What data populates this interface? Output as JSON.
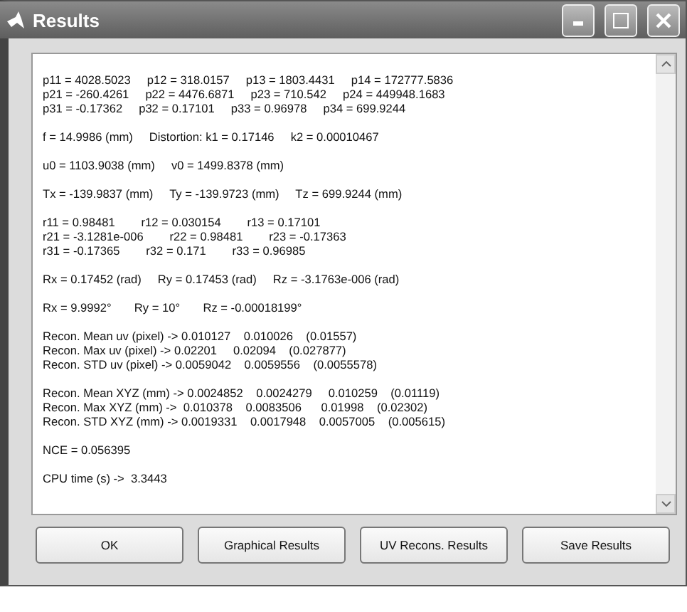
{
  "window": {
    "title": "Results"
  },
  "results": [
    [
      "p11 = 4028.5023     p12 = 318.0157     p13 = 1803.4431     p14 = 172777.5836",
      "p21 = -260.4261     p22 = 4476.6871     p23 = 710.542     p24 = 449948.1683",
      "p31 = -0.17362     p32 = 0.17101     p33 = 0.96978     p34 = 699.9244"
    ],
    [
      "f = 14.9986 (mm)     Distortion: k1 = 0.17146     k2 = 0.00010467"
    ],
    [
      "u0 = 1103.9038 (mm)     v0 = 1499.8378 (mm)"
    ],
    [
      "Tx = -139.9837 (mm)     Ty = -139.9723 (mm)     Tz = 699.9244 (mm)"
    ],
    [
      "r11 = 0.98481        r12 = 0.030154        r13 = 0.17101",
      "r21 = -3.1281e-006        r22 = 0.98481        r23 = -0.17363",
      "r31 = -0.17365        r32 = 0.171        r33 = 0.96985"
    ],
    [
      "Rx = 0.17452 (rad)     Ry = 0.17453 (rad)     Rz = -3.1763e-006 (rad)"
    ],
    [
      "Rx = 9.9992°       Ry = 10°       Rz = -0.00018199°"
    ],
    [
      "Recon. Mean uv (pixel) -> 0.010127    0.010026    (0.01557)",
      "Recon. Max uv (pixel) -> 0.02201     0.02094    (0.027877)",
      "Recon. STD uv (pixel) -> 0.0059042    0.0059556    (0.0055578)"
    ],
    [
      "Recon. Mean XYZ (mm) -> 0.0024852    0.0024279     0.010259    (0.01119)",
      "Recon. Max XYZ (mm) ->  0.010378    0.0083506      0.01998    (0.02302)",
      "Recon. STD XYZ (mm) -> 0.0019331    0.0017948    0.0057005    (0.005615)"
    ],
    [
      "NCE = 0.056395"
    ],
    [
      "CPU time (s) ->  3.3443"
    ]
  ],
  "buttons": [
    "OK",
    "Graphical Results",
    "UV Recons. Results",
    "Save Results"
  ]
}
